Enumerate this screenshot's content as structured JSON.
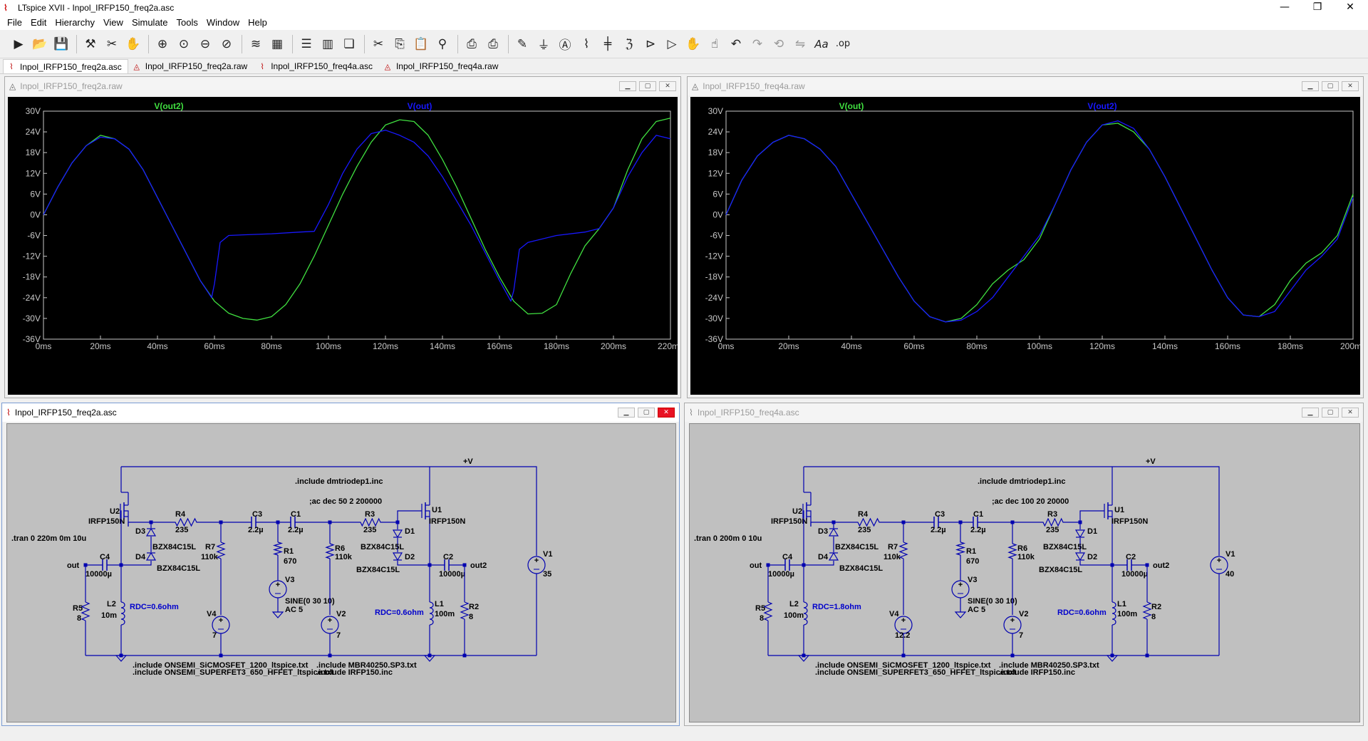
{
  "app": {
    "title": "LTspice XVII - Inpol_IRFP150_freq2a.asc",
    "controls": {
      "minimize": "—",
      "maximize": "❐",
      "close": "✕"
    }
  },
  "menu": [
    "File",
    "Edit",
    "Hierarchy",
    "View",
    "Simulate",
    "Tools",
    "Window",
    "Help"
  ],
  "toolbar_icons": [
    "run-icon",
    "open-icon",
    "save-icon",
    "control-panel-icon",
    "halt-icon",
    "pan-icon",
    "zoom-in-icon",
    "zoom-back-icon",
    "zoom-out-icon",
    "zoom-fit-icon",
    "autorange-icon",
    "grid-icon",
    "tile-horizontal-icon",
    "tile-vertical-icon",
    "cascade-icon",
    "cut-icon",
    "copy-icon",
    "paste-icon",
    "find-icon",
    "print-icon",
    "print-preview-icon",
    "wire-icon",
    "ground-icon",
    "label-net-icon",
    "resistor-icon",
    "capacitor-icon",
    "inductor-icon",
    "diode-icon",
    "component-icon",
    "move-icon",
    "drag-icon",
    "undo-icon",
    "redo-icon",
    "rotate-icon",
    "mirror-icon",
    "text-icon",
    "spice-directive-icon"
  ],
  "toolbar_glyphs": {
    "text": "Aa",
    "directive": ".op"
  },
  "tabs": [
    {
      "label": "Inpol_IRFP150_freq2a.asc",
      "kind": "schematic",
      "active": true
    },
    {
      "label": "Inpol_IRFP150_freq2a.raw",
      "kind": "waveform",
      "active": false
    },
    {
      "label": "Inpol_IRFP150_freq4a.asc",
      "kind": "schematic",
      "active": false
    },
    {
      "label": "Inpol_IRFP150_freq4a.raw",
      "kind": "waveform",
      "active": false
    }
  ],
  "colors": {
    "green": "#40e040",
    "blue": "#1818ff",
    "axis": "#c8c8c8",
    "grid": "#555555",
    "schematic_bg": "#c0c0c0",
    "wire": "#0000b0"
  },
  "windows": {
    "wave1": {
      "title": "Inpol_IRFP150_freq2a.raw",
      "legend": [
        {
          "label": "V(out2)",
          "color": "#40e040"
        },
        {
          "label": "V(out)",
          "color": "#1818ff"
        }
      ]
    },
    "wave2": {
      "title": "Inpol_IRFP150_freq4a.raw",
      "legend": [
        {
          "label": "V(out)",
          "color": "#40e040"
        },
        {
          "label": "V(out2)",
          "color": "#1818ff"
        }
      ]
    },
    "sch1": {
      "title": "Inpol_IRFP150_freq2a.asc",
      "labels": {
        "vplus": "+V",
        "inc1": ".include dmtriodep1.inc",
        "ac": ";ac dec 50 2 200000",
        "tran": ".tran 0 220m 0m 10u",
        "u2": "U2",
        "u2m": "IRFP150N",
        "u1": "U1",
        "u1m": "IRFP150N",
        "r4": "R4",
        "r4v": "235",
        "r3": "R3",
        "r3v": "235",
        "c3": "C3",
        "c3v": "2.2µ",
        "c1": "C1",
        "c1v": "2.2µ",
        "d3": "D3",
        "d4": "D4",
        "d3m": "BZX84C15L",
        "d4m": "BZX84C15L",
        "d1": "D1",
        "d2": "D2",
        "d1m": "BZX84C15L",
        "d2m": "BZX84C15L",
        "r7": "R7",
        "r7v": "110k",
        "r1": "R1",
        "r1v": "670",
        "r6": "R6",
        "r6v": "110k",
        "c4": "C4",
        "c4v": "10000µ",
        "c2": "C2",
        "c2v": "10000µ",
        "out": "out",
        "out2": "out2",
        "v3": "V3",
        "v3a": "SINE(0 30 10)",
        "v3b": "AC 5",
        "r5": "R5",
        "r5v": "8",
        "l2": "L2",
        "l2v": "10m",
        "l2r": "RDC=0.6ohm",
        "v4": "V4",
        "v4v": "7",
        "v2": "V2",
        "v2v": "7",
        "l1": "L1",
        "l1v": "100m",
        "l1r": "RDC=0.6ohm",
        "r2": "R2",
        "r2v": "8",
        "v1": "V1",
        "v1v": "35",
        "inc2": ".include ONSEMI_SiCMOSFET_1200_ltspice.txt",
        "inc3": ".include ONSEMI_SUPERFET3_650_HFFET_ltspice.txt",
        "inc4": ".include MBR40250.SP3.txt",
        "inc5": ".include IRFP150.inc"
      }
    },
    "sch2": {
      "title": "Inpol_IRFP150_freq4a.asc",
      "labels": {
        "vplus": "+V",
        "inc1": ".include dmtriodep1.inc",
        "ac": ";ac dec 100 20 20000",
        "tran": ".tran 0 200m 0 10u",
        "u2": "U2",
        "u2m": "IRFP150N",
        "u1": "U1",
        "u1m": "IRFP150N",
        "r4": "R4",
        "r4v": "235",
        "r3": "R3",
        "r3v": "235",
        "c3": "C3",
        "c3v": "2.2µ",
        "c1": "C1",
        "c1v": "2.2µ",
        "d3": "D3",
        "d4": "D4",
        "d3m": "BZX84C15L",
        "d4m": "BZX84C15L",
        "d1": "D1",
        "d2": "D2",
        "d1m": "BZX84C15L",
        "d2m": "BZX84C15L",
        "r7": "R7",
        "r7v": "110k",
        "r1": "R1",
        "r1v": "670",
        "r6": "R6",
        "r6v": "110k",
        "c4": "C4",
        "c4v": "10000µ",
        "c2": "C2",
        "c2v": "10000µ",
        "out": "out",
        "out2": "out2",
        "v3": "V3",
        "v3a": "SINE(0 30 10)",
        "v3b": "AC 5",
        "r5": "R5",
        "r5v": "8",
        "l2": "L2",
        "l2v": "100m",
        "l2r": "RDC=1.8ohm",
        "v4": "V4",
        "v4v": "12.2",
        "v2": "V2",
        "v2v": "7",
        "l1": "L1",
        "l1v": "100m",
        "l1r": "RDC=0.6ohm",
        "r2": "R2",
        "r2v": "8",
        "v1": "V1",
        "v1v": "40",
        "inc2": ".include ONSEMI_SiCMOSFET_1200_ltspice.txt",
        "inc3": ".include ONSEMI_SUPERFET3_650_HFFET_ltspice.txt",
        "inc4": ".include MBR40250.SP3.txt",
        "inc5": ".include IRFP150.inc"
      }
    }
  },
  "chart_data": [
    {
      "type": "line",
      "title": "",
      "xlabel": "",
      "ylabel": "",
      "xlim": [
        0,
        220
      ],
      "ylim": [
        -36,
        30
      ],
      "x_ticks": [
        "0ms",
        "20ms",
        "40ms",
        "60ms",
        "80ms",
        "100ms",
        "120ms",
        "140ms",
        "160ms",
        "180ms",
        "200ms",
        "220ms"
      ],
      "y_ticks": [
        "30V",
        "24V",
        "18V",
        "12V",
        "6V",
        "0V",
        "-6V",
        "-12V",
        "-18V",
        "-24V",
        "-30V",
        "-36V"
      ],
      "grid": false,
      "legend": "top",
      "series": [
        {
          "name": "V(out2)",
          "color": "#40e040",
          "x": [
            0,
            5,
            10,
            15,
            20,
            25,
            30,
            35,
            40,
            45,
            50,
            55,
            60,
            65,
            70,
            75,
            80,
            85,
            90,
            95,
            100,
            105,
            110,
            115,
            120,
            125,
            130,
            135,
            140,
            145,
            150,
            155,
            160,
            165,
            170,
            175,
            180,
            185,
            190,
            195,
            200,
            205,
            210,
            215,
            220
          ],
          "y": [
            0,
            8,
            15,
            20,
            23,
            22,
            19,
            13,
            5,
            -3,
            -11,
            -19,
            -25,
            -28.5,
            -30,
            -30.5,
            -29.5,
            -26,
            -20,
            -12,
            -3,
            6,
            14,
            21,
            26,
            27.5,
            27,
            23,
            16,
            8,
            -1,
            -10,
            -18,
            -25,
            -28.7,
            -28.5,
            -26,
            -17,
            -9,
            -4,
            2,
            13,
            22,
            27,
            28
          ]
        },
        {
          "name": "V(out)",
          "color": "#1818ff",
          "x": [
            0,
            5,
            10,
            15,
            20,
            25,
            30,
            35,
            40,
            45,
            50,
            55,
            59,
            60,
            62,
            65,
            70,
            80,
            90,
            95,
            100,
            105,
            110,
            115,
            120,
            125,
            130,
            135,
            140,
            145,
            150,
            155,
            160,
            164,
            165,
            167,
            170,
            180,
            190,
            195,
            200,
            205,
            210,
            215,
            220
          ],
          "y": [
            0,
            8,
            15,
            20,
            22.5,
            22,
            19,
            13,
            5,
            -3,
            -11,
            -19,
            -24,
            -20,
            -8,
            -6,
            -5.8,
            -5.5,
            -5,
            -4.8,
            3,
            12,
            19,
            23.5,
            24.5,
            23,
            21,
            17,
            11,
            4,
            -3,
            -11,
            -19,
            -25,
            -22,
            -10,
            -8,
            -6,
            -5,
            -4,
            2,
            11,
            18,
            23,
            22
          ]
        }
      ]
    },
    {
      "type": "line",
      "title": "",
      "xlabel": "",
      "ylabel": "",
      "xlim": [
        0,
        200
      ],
      "ylim": [
        -36,
        30
      ],
      "x_ticks": [
        "0ms",
        "20ms",
        "40ms",
        "60ms",
        "80ms",
        "100ms",
        "120ms",
        "140ms",
        "160ms",
        "180ms",
        "200ms"
      ],
      "y_ticks": [
        "30V",
        "24V",
        "18V",
        "12V",
        "6V",
        "0V",
        "-6V",
        "-12V",
        "-18V",
        "-24V",
        "-30V",
        "-36V"
      ],
      "grid": false,
      "legend": "top",
      "series": [
        {
          "name": "V(out)",
          "color": "#40e040",
          "x": [
            0,
            5,
            10,
            15,
            20,
            25,
            30,
            35,
            40,
            45,
            50,
            55,
            60,
            65,
            70,
            75,
            80,
            85,
            90,
            95,
            100,
            105,
            110,
            115,
            120,
            125,
            130,
            135,
            140,
            145,
            150,
            155,
            160,
            165,
            170,
            175,
            180,
            185,
            190,
            195,
            200
          ],
          "y": [
            0,
            10,
            17,
            21,
            23,
            22,
            19,
            14,
            6,
            -2,
            -10,
            -18,
            -25,
            -29.5,
            -31,
            -30,
            -26,
            -20,
            -16,
            -13,
            -7,
            3,
            13,
            21,
            26,
            26.5,
            24,
            19,
            11,
            2,
            -7,
            -16,
            -24,
            -29,
            -29.5,
            -26,
            -19,
            -14,
            -11,
            -6,
            6
          ]
        },
        {
          "name": "V(out2)",
          "color": "#1818ff",
          "x": [
            0,
            5,
            10,
            15,
            20,
            25,
            30,
            35,
            40,
            45,
            50,
            55,
            60,
            65,
            70,
            75,
            80,
            85,
            90,
            95,
            100,
            105,
            110,
            115,
            120,
            125,
            130,
            135,
            140,
            145,
            150,
            155,
            160,
            165,
            170,
            175,
            180,
            185,
            190,
            195,
            200
          ],
          "y": [
            0,
            10,
            17,
            21,
            23,
            22,
            19,
            14,
            6,
            -2,
            -10,
            -18,
            -25,
            -29.5,
            -31,
            -30.5,
            -28,
            -24,
            -18,
            -12,
            -6,
            3,
            13,
            21,
            26,
            27.2,
            25,
            19,
            11,
            2,
            -7,
            -16,
            -24,
            -29,
            -29.5,
            -28,
            -22,
            -16,
            -12,
            -7,
            5
          ]
        }
      ]
    }
  ]
}
